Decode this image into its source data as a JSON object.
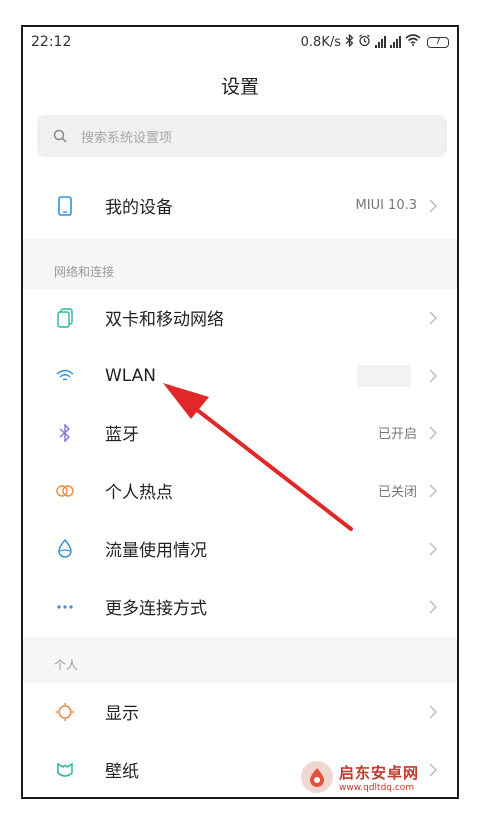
{
  "status": {
    "time": "22:12",
    "speed": "0.8K/s",
    "battery": "7"
  },
  "page": {
    "title": "设置"
  },
  "search": {
    "placeholder": "搜索系统设置项"
  },
  "device": {
    "label": "我的设备",
    "value": "MIUI 10.3"
  },
  "sections": {
    "network": "网络和连接",
    "personal": "个人"
  },
  "network_items": [
    {
      "label": "双卡和移动网络",
      "value": ""
    },
    {
      "label": "WLAN",
      "value": ""
    },
    {
      "label": "蓝牙",
      "value": "已开启"
    },
    {
      "label": "个人热点",
      "value": "已关闭"
    },
    {
      "label": "流量使用情况",
      "value": ""
    },
    {
      "label": "更多连接方式",
      "value": ""
    }
  ],
  "personal_items": [
    {
      "label": "显示"
    },
    {
      "label": "壁纸"
    }
  ],
  "watermark": {
    "title": "启东安卓网",
    "url": "www.qdltdq.com"
  },
  "colors": {
    "accent_blue": "#3a8fd6",
    "arrow_red": "#e02828",
    "hotspot_orange": "#f08a3c",
    "bluetooth_purple": "#8a6fd6",
    "wallpaper_teal": "#2bb5a0"
  },
  "icons": {
    "device": "phone-icon",
    "sim": "sim-card-icon",
    "wlan": "wifi-icon",
    "bluetooth": "bluetooth-icon",
    "hotspot": "hotspot-icon",
    "data_usage": "droplet-icon",
    "more": "more-dots-icon",
    "display": "sun-icon",
    "wallpaper": "wallpaper-icon"
  }
}
